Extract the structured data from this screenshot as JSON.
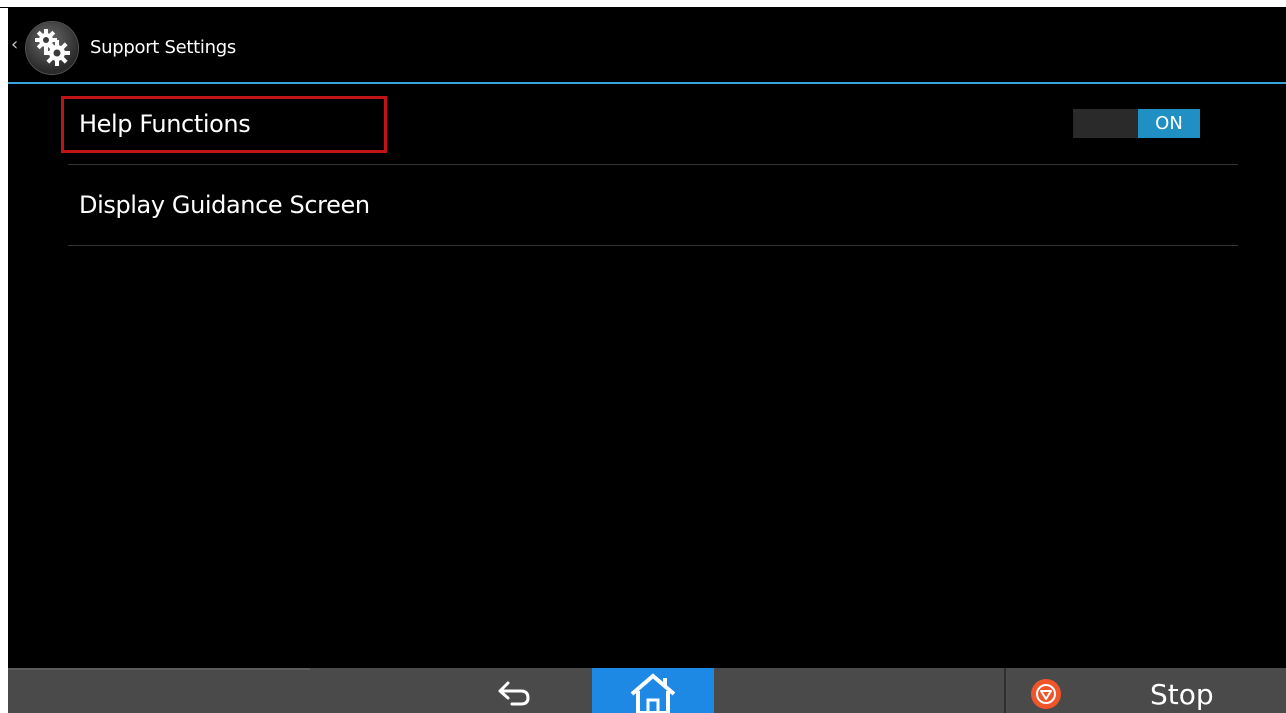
{
  "header": {
    "back_glyph": "‹",
    "app_icon": "gears-icon",
    "title": "Support Settings"
  },
  "settings": {
    "items": [
      {
        "label": "Help Functions",
        "toggle": "ON",
        "highlighted": true
      },
      {
        "label": "Display Guidance Screen"
      }
    ]
  },
  "bottom_bar": {
    "back_icon": "undo-arrow-icon",
    "home_icon": "home-icon",
    "stop_icon": "stop-icon",
    "stop_label": "Stop"
  },
  "colors": {
    "accent": "#1e88e5",
    "header_line": "#3aa3d8",
    "toggle_on": "#1f8fc4",
    "highlight": "#c01418",
    "stop": "#f0552a"
  }
}
